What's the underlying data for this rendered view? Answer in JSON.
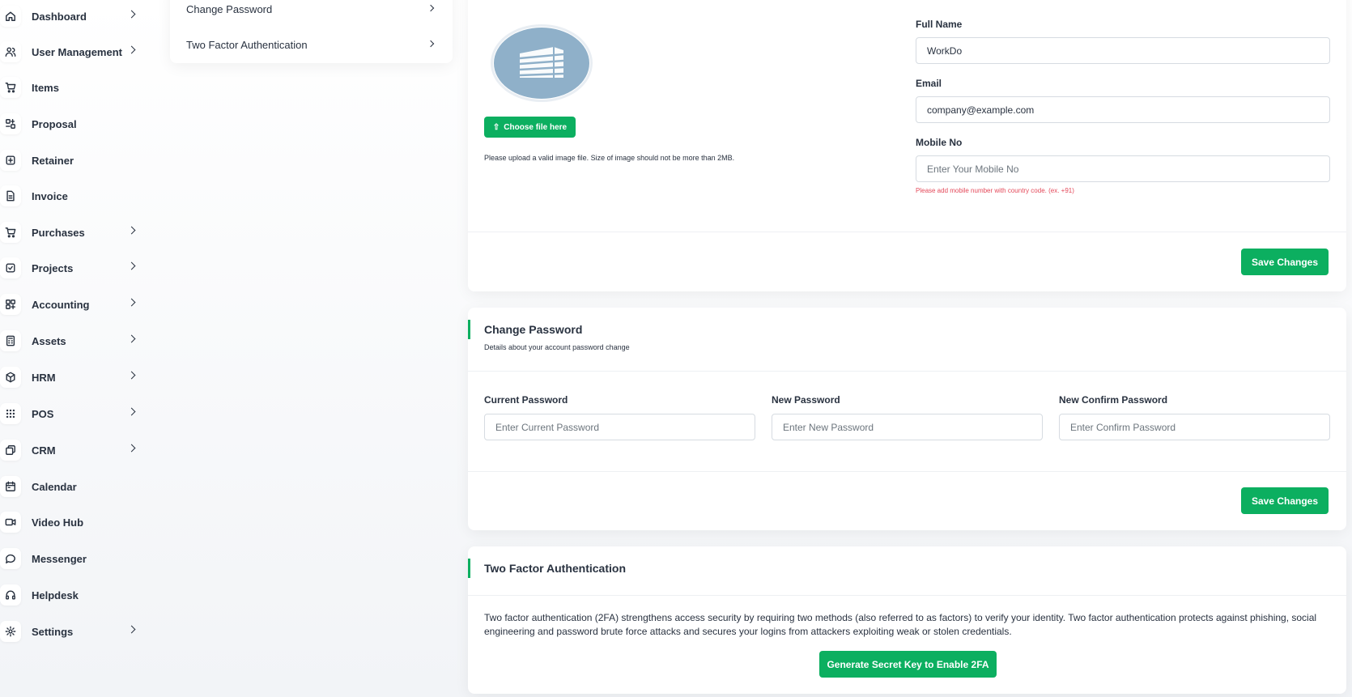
{
  "sidebar": {
    "items": [
      {
        "label": "Dashboard",
        "icon": "home-icon",
        "has_submenu": true
      },
      {
        "label": "User Management",
        "icon": "users-icon",
        "has_submenu": true
      },
      {
        "label": "Items",
        "icon": "cart-icon",
        "has_submenu": false
      },
      {
        "label": "Proposal",
        "icon": "proposal-icon",
        "has_submenu": false
      },
      {
        "label": "Retainer",
        "icon": "retainer-icon",
        "has_submenu": false
      },
      {
        "label": "Invoice",
        "icon": "invoice-icon",
        "has_submenu": false
      },
      {
        "label": "Purchases",
        "icon": "cart-icon",
        "has_submenu": true
      },
      {
        "label": "Projects",
        "icon": "checkbox-icon",
        "has_submenu": true
      },
      {
        "label": "Accounting",
        "icon": "grid-plus-icon",
        "has_submenu": true
      },
      {
        "label": "Assets",
        "icon": "calculator-icon",
        "has_submenu": true
      },
      {
        "label": "HRM",
        "icon": "cube-icon",
        "has_submenu": true
      },
      {
        "label": "POS",
        "icon": "dots-grid-icon",
        "has_submenu": true
      },
      {
        "label": "CRM",
        "icon": "layers-icon",
        "has_submenu": true
      },
      {
        "label": "Calendar",
        "icon": "calendar-icon",
        "has_submenu": false
      },
      {
        "label": "Video Hub",
        "icon": "video-icon",
        "has_submenu": false
      },
      {
        "label": "Messenger",
        "icon": "chat-icon",
        "has_submenu": false
      },
      {
        "label": "Helpdesk",
        "icon": "headphones-icon",
        "has_submenu": false
      },
      {
        "label": "Settings",
        "icon": "gear-icon",
        "has_submenu": true
      }
    ]
  },
  "settings_menu": {
    "items": [
      {
        "label": "Change Password"
      },
      {
        "label": "Two Factor Authentication"
      }
    ]
  },
  "personal_info": {
    "choose_file_label": "Choose file here",
    "upload_note": "Please upload a valid image file. Size of image should not be more than 2MB.",
    "full_name_label": "Full Name",
    "full_name_value": "WorkDo",
    "email_label": "Email",
    "email_value": "company@example.com",
    "mobile_label": "Mobile No",
    "mobile_placeholder": "Enter Your Mobile No",
    "mobile_hint": "Please add mobile number with country code. (ex. +91)",
    "save_label": "Save Changes"
  },
  "change_password": {
    "title": "Change Password",
    "subtitle": "Details about your account password change",
    "current_label": "Current Password",
    "current_placeholder": "Enter Current Password",
    "new_label": "New Password",
    "new_placeholder": "Enter New Password",
    "confirm_label": "New Confirm Password",
    "confirm_placeholder": "Enter Confirm Password",
    "save_label": "Save Changes"
  },
  "two_factor": {
    "title": "Two Factor Authentication",
    "description": "Two factor authentication (2FA) strengthens access security by requiring two methods (also referred to as factors) to verify your identity. Two factor authentication protects against phishing, social engineering and password brute force attacks and secures your logins from attackers exploiting weak or stolen credentials.",
    "button_label": "Generate Secret Key to Enable 2FA"
  },
  "colors": {
    "accent": "#0caf60",
    "avatar_bg": "#8fb0c9",
    "hint": "#e4495a"
  }
}
